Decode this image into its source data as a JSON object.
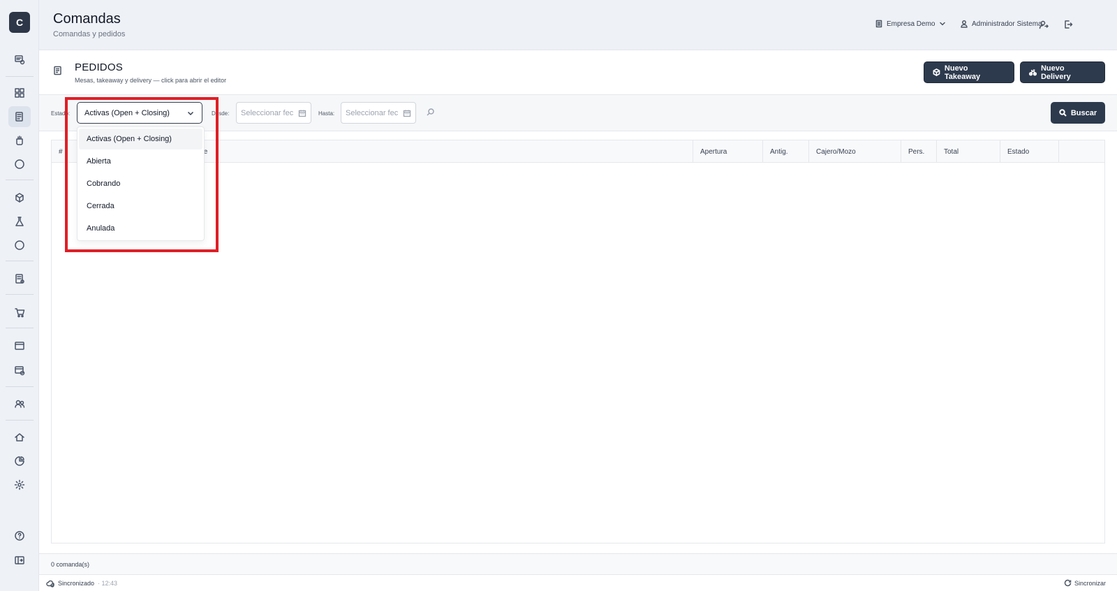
{
  "app": {
    "logo_letter": "C"
  },
  "header": {
    "title": "Comandas",
    "subtitle": "Comandas y pedidos",
    "company": "Empresa Demo",
    "user": "Administrador Sistema"
  },
  "section": {
    "title": "PEDIDOS",
    "subtitle": "Mesas, takeaway y delivery — click para abrir el editor",
    "btn_takeaway": "Nuevo Takeaway",
    "btn_delivery": "Nuevo Delivery"
  },
  "filters": {
    "estado_label": "Estado:",
    "estado_value": "Activas (Open + Closing)",
    "desde_label": "Desde:",
    "desde_placeholder": "Seleccionar fec",
    "hasta_label": "Hasta:",
    "hasta_placeholder": "Seleccionar fec",
    "buscar": "Buscar"
  },
  "dropdown": {
    "options": [
      "Activas (Open + Closing)",
      "Abierta",
      "Cobrando",
      "Cerrada",
      "Anulada"
    ],
    "selected": "Activas (Open + Closing)"
  },
  "table": {
    "columns": [
      "#",
      "te",
      "Apertura",
      "Antig.",
      "Cajero/Mozo",
      "Pers.",
      "Total",
      "Estado"
    ]
  },
  "footer": {
    "count": "0 comanda(s)",
    "sync_status": "Sincronizado",
    "sync_time": "· 12:43",
    "sync_button": "Sincronizar"
  },
  "colors": {
    "primary": "#2d3a4d",
    "highlight": "#e01e26",
    "sidebar_bg": "#eef1f6"
  }
}
